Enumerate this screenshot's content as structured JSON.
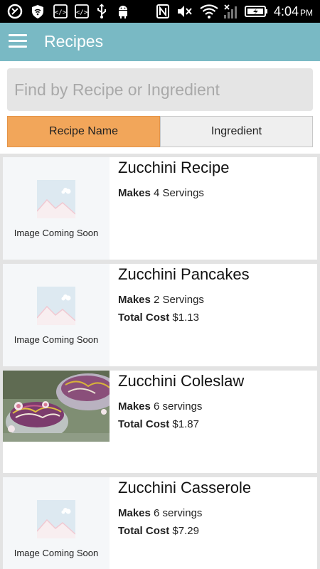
{
  "status_bar": {
    "time": "4:04",
    "ampm": "PM",
    "icons": [
      "sync-icon",
      "shield-wifi-icon",
      "code-icon",
      "code-icon",
      "usb-icon",
      "android-icon",
      "nfc-icon",
      "mute-icon",
      "wifi-icon",
      "signal-icon",
      "battery-charging-icon"
    ]
  },
  "app_bar": {
    "title": "Recipes",
    "menu_icon": "hamburger-icon",
    "color": "#79b9c4"
  },
  "search": {
    "placeholder": "Find by Recipe or Ingredient",
    "value": ""
  },
  "toggle": {
    "recipe_name_label": "Recipe Name",
    "ingredient_label": "Ingredient",
    "selected": "Recipe Name",
    "accent": "#f2a65a"
  },
  "recipes": [
    {
      "title": "Zucchini Recipe",
      "makes_label": "Makes",
      "makes_value": "4 Servings",
      "cost_label": "",
      "cost_value": "",
      "image_text": "Image Coming Soon",
      "has_photo": false
    },
    {
      "title": "Zucchini Pancakes",
      "makes_label": "Makes",
      "makes_value": "2 Servings",
      "cost_label": "Total Cost",
      "cost_value": "$1.13",
      "image_text": "Image Coming Soon",
      "has_photo": false
    },
    {
      "title": "Zucchini Coleslaw",
      "makes_label": "Makes",
      "makes_value": "6 servings",
      "cost_label": "Total Cost",
      "cost_value": "$1.87",
      "image_text": "",
      "has_photo": true
    },
    {
      "title": "Zucchini Casserole",
      "makes_label": "Makes",
      "makes_value": "6 servings",
      "cost_label": "Total Cost",
      "cost_value": "$7.29",
      "image_text": "Image Coming Soon",
      "has_photo": false
    }
  ]
}
